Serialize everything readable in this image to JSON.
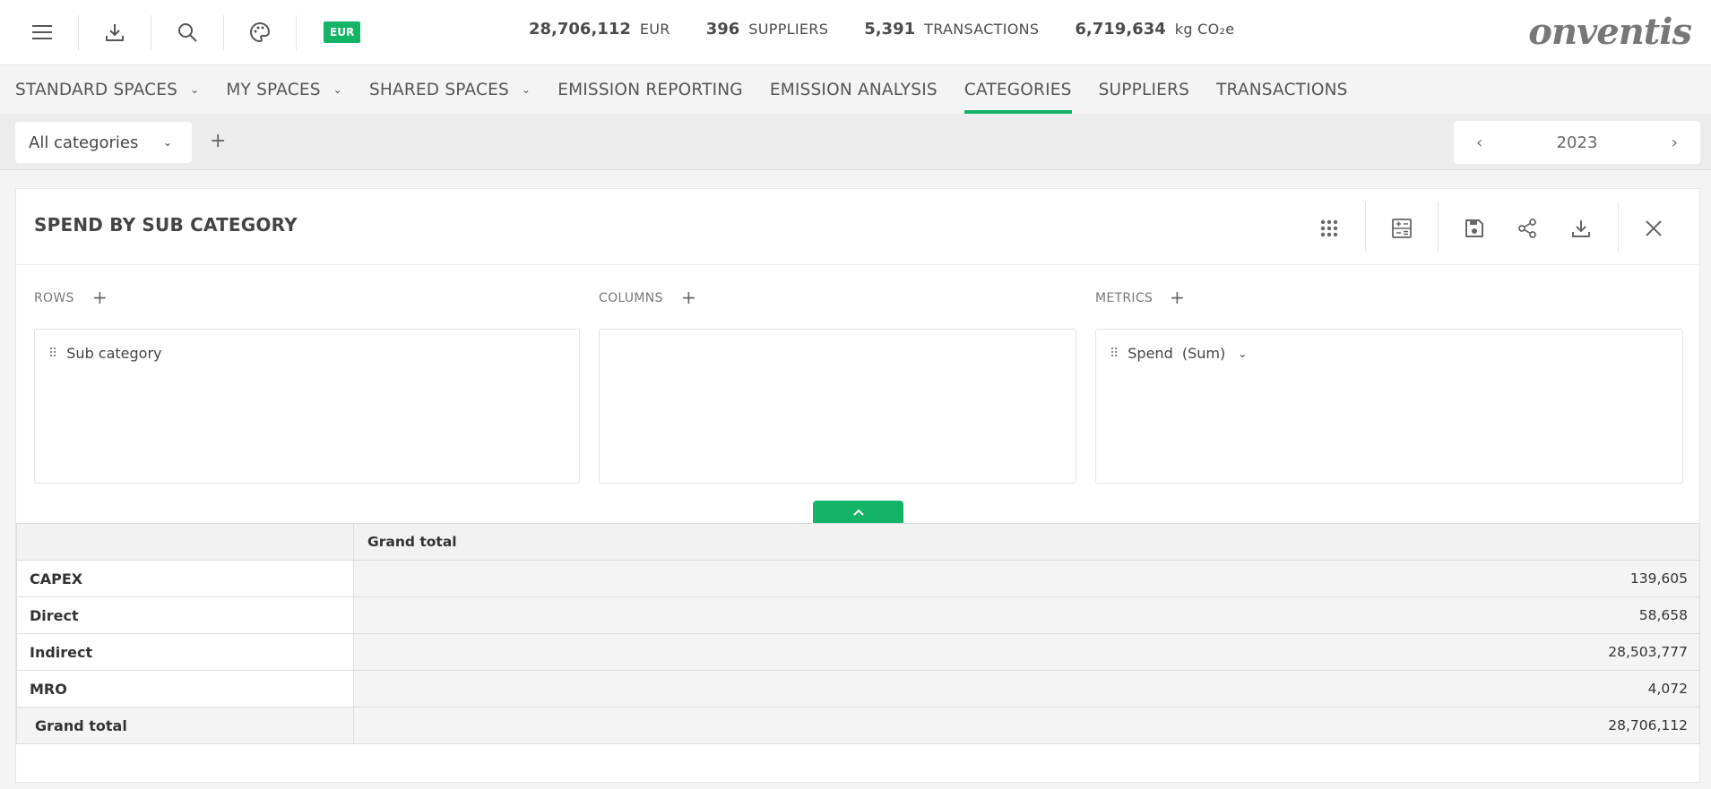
{
  "header": {
    "currency_badge": "EUR",
    "stats": [
      {
        "value": "28,706,112",
        "unit": "EUR"
      },
      {
        "value": "396",
        "unit": "SUPPLIERS"
      },
      {
        "value": "5,391",
        "unit": "TRANSACTIONS"
      },
      {
        "value": "6,719,634",
        "unit": "kg CO₂e"
      }
    ],
    "logo": "onventis",
    "icons": [
      "menu-icon",
      "download-icon",
      "search-icon",
      "palette-icon"
    ]
  },
  "nav": {
    "items": [
      {
        "label": "STANDARD SPACES",
        "dropdown": true
      },
      {
        "label": "MY SPACES",
        "dropdown": true
      },
      {
        "label": "SHARED SPACES",
        "dropdown": true
      },
      {
        "label": "EMISSION REPORTING",
        "dropdown": false
      },
      {
        "label": "EMISSION ANALYSIS",
        "dropdown": false
      },
      {
        "label": "CATEGORIES",
        "dropdown": false,
        "active": true
      },
      {
        "label": "SUPPLIERS",
        "dropdown": false
      },
      {
        "label": "TRANSACTIONS",
        "dropdown": false
      }
    ],
    "accent_color": "#14b467"
  },
  "filters": {
    "category_select": "All categories",
    "add_label": "+",
    "year": "2023"
  },
  "panel": {
    "title": "SPEND BY SUB CATEGORY",
    "rows": {
      "label": "ROWS",
      "items": [
        "Sub category"
      ]
    },
    "columns": {
      "label": "COLUMNS",
      "items": []
    },
    "metrics": {
      "label": "METRICS",
      "items": [
        "Spend  (Sum)"
      ]
    }
  },
  "table": {
    "column_header": "Grand total",
    "rows": [
      {
        "label": "CAPEX",
        "value": "139,605"
      },
      {
        "label": "Direct",
        "value": "58,658"
      },
      {
        "label": "Indirect",
        "value": "28,503,777"
      },
      {
        "label": "MRO",
        "value": "4,072"
      }
    ],
    "total": {
      "label": "Grand total",
      "value": "28,706,112"
    }
  }
}
